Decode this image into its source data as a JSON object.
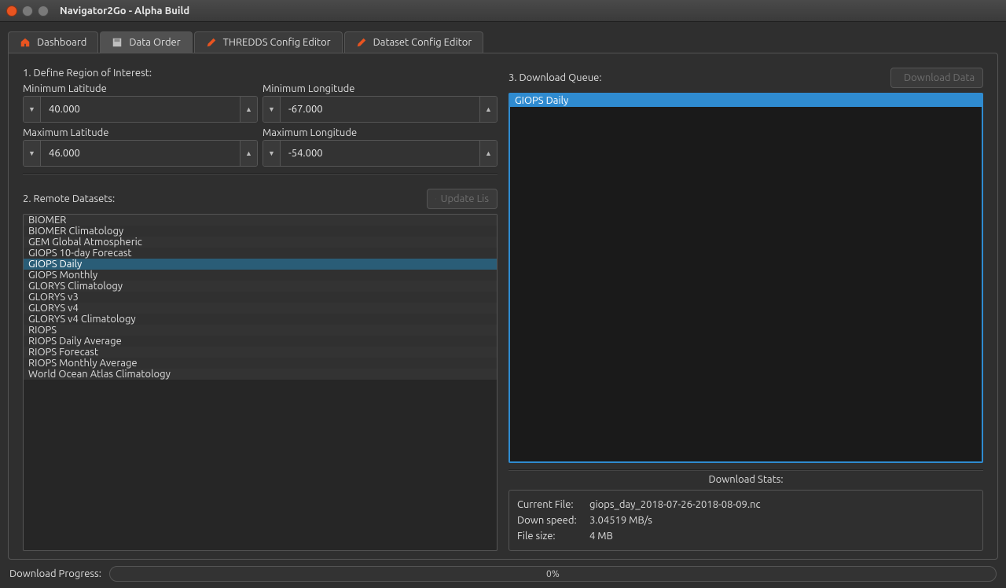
{
  "window": {
    "title": "Navigator2Go - Alpha Build"
  },
  "tabs": {
    "dashboard": "Dashboard",
    "data_order": "Data Order",
    "thredds": "THREDDS Config Editor",
    "dataset": "Dataset Config Editor"
  },
  "region": {
    "heading": "1. Define Region of Interest:",
    "min_lat_label": "Minimum Latitude",
    "min_lon_label": "Minimum Longitude",
    "max_lat_label": "Maximum Latitude",
    "max_lon_label": "Maximum Longitude",
    "min_lat": "40.000",
    "min_lon": "-67.000",
    "max_lat": "46.000",
    "max_lon": "-54.000"
  },
  "remote": {
    "heading": "2. Remote Datasets:",
    "update_btn": "Update Lis",
    "items": [
      "BIOMER",
      "BIOMER Climatology",
      "GEM Global Atmospheric",
      "GIOPS 10-day Forecast",
      "GIOPS Daily",
      "GIOPS Monthly",
      "GLORYS Climatology",
      "GLORYS v3",
      "GLORYS v4",
      "GLORYS v4 Climatology",
      "RIOPS",
      "RIOPS Daily Average",
      "RIOPS Forecast",
      "RIOPS Monthly Average",
      "World Ocean Atlas Climatology"
    ],
    "selected_index": 4
  },
  "queue": {
    "heading": "3. Download Queue:",
    "download_btn": "Download Data",
    "items": [
      "GIOPS Daily"
    ]
  },
  "stats": {
    "heading": "Download Stats:",
    "current_file_label": "Current File:",
    "current_file": "giops_day_2018-07-26-2018-08-09.nc",
    "speed_label": "Down speed:",
    "speed": "3.04519 MB/s",
    "size_label": "File size:",
    "size": "4 MB"
  },
  "footer": {
    "label": "Download Progress:",
    "percent": "0%"
  }
}
